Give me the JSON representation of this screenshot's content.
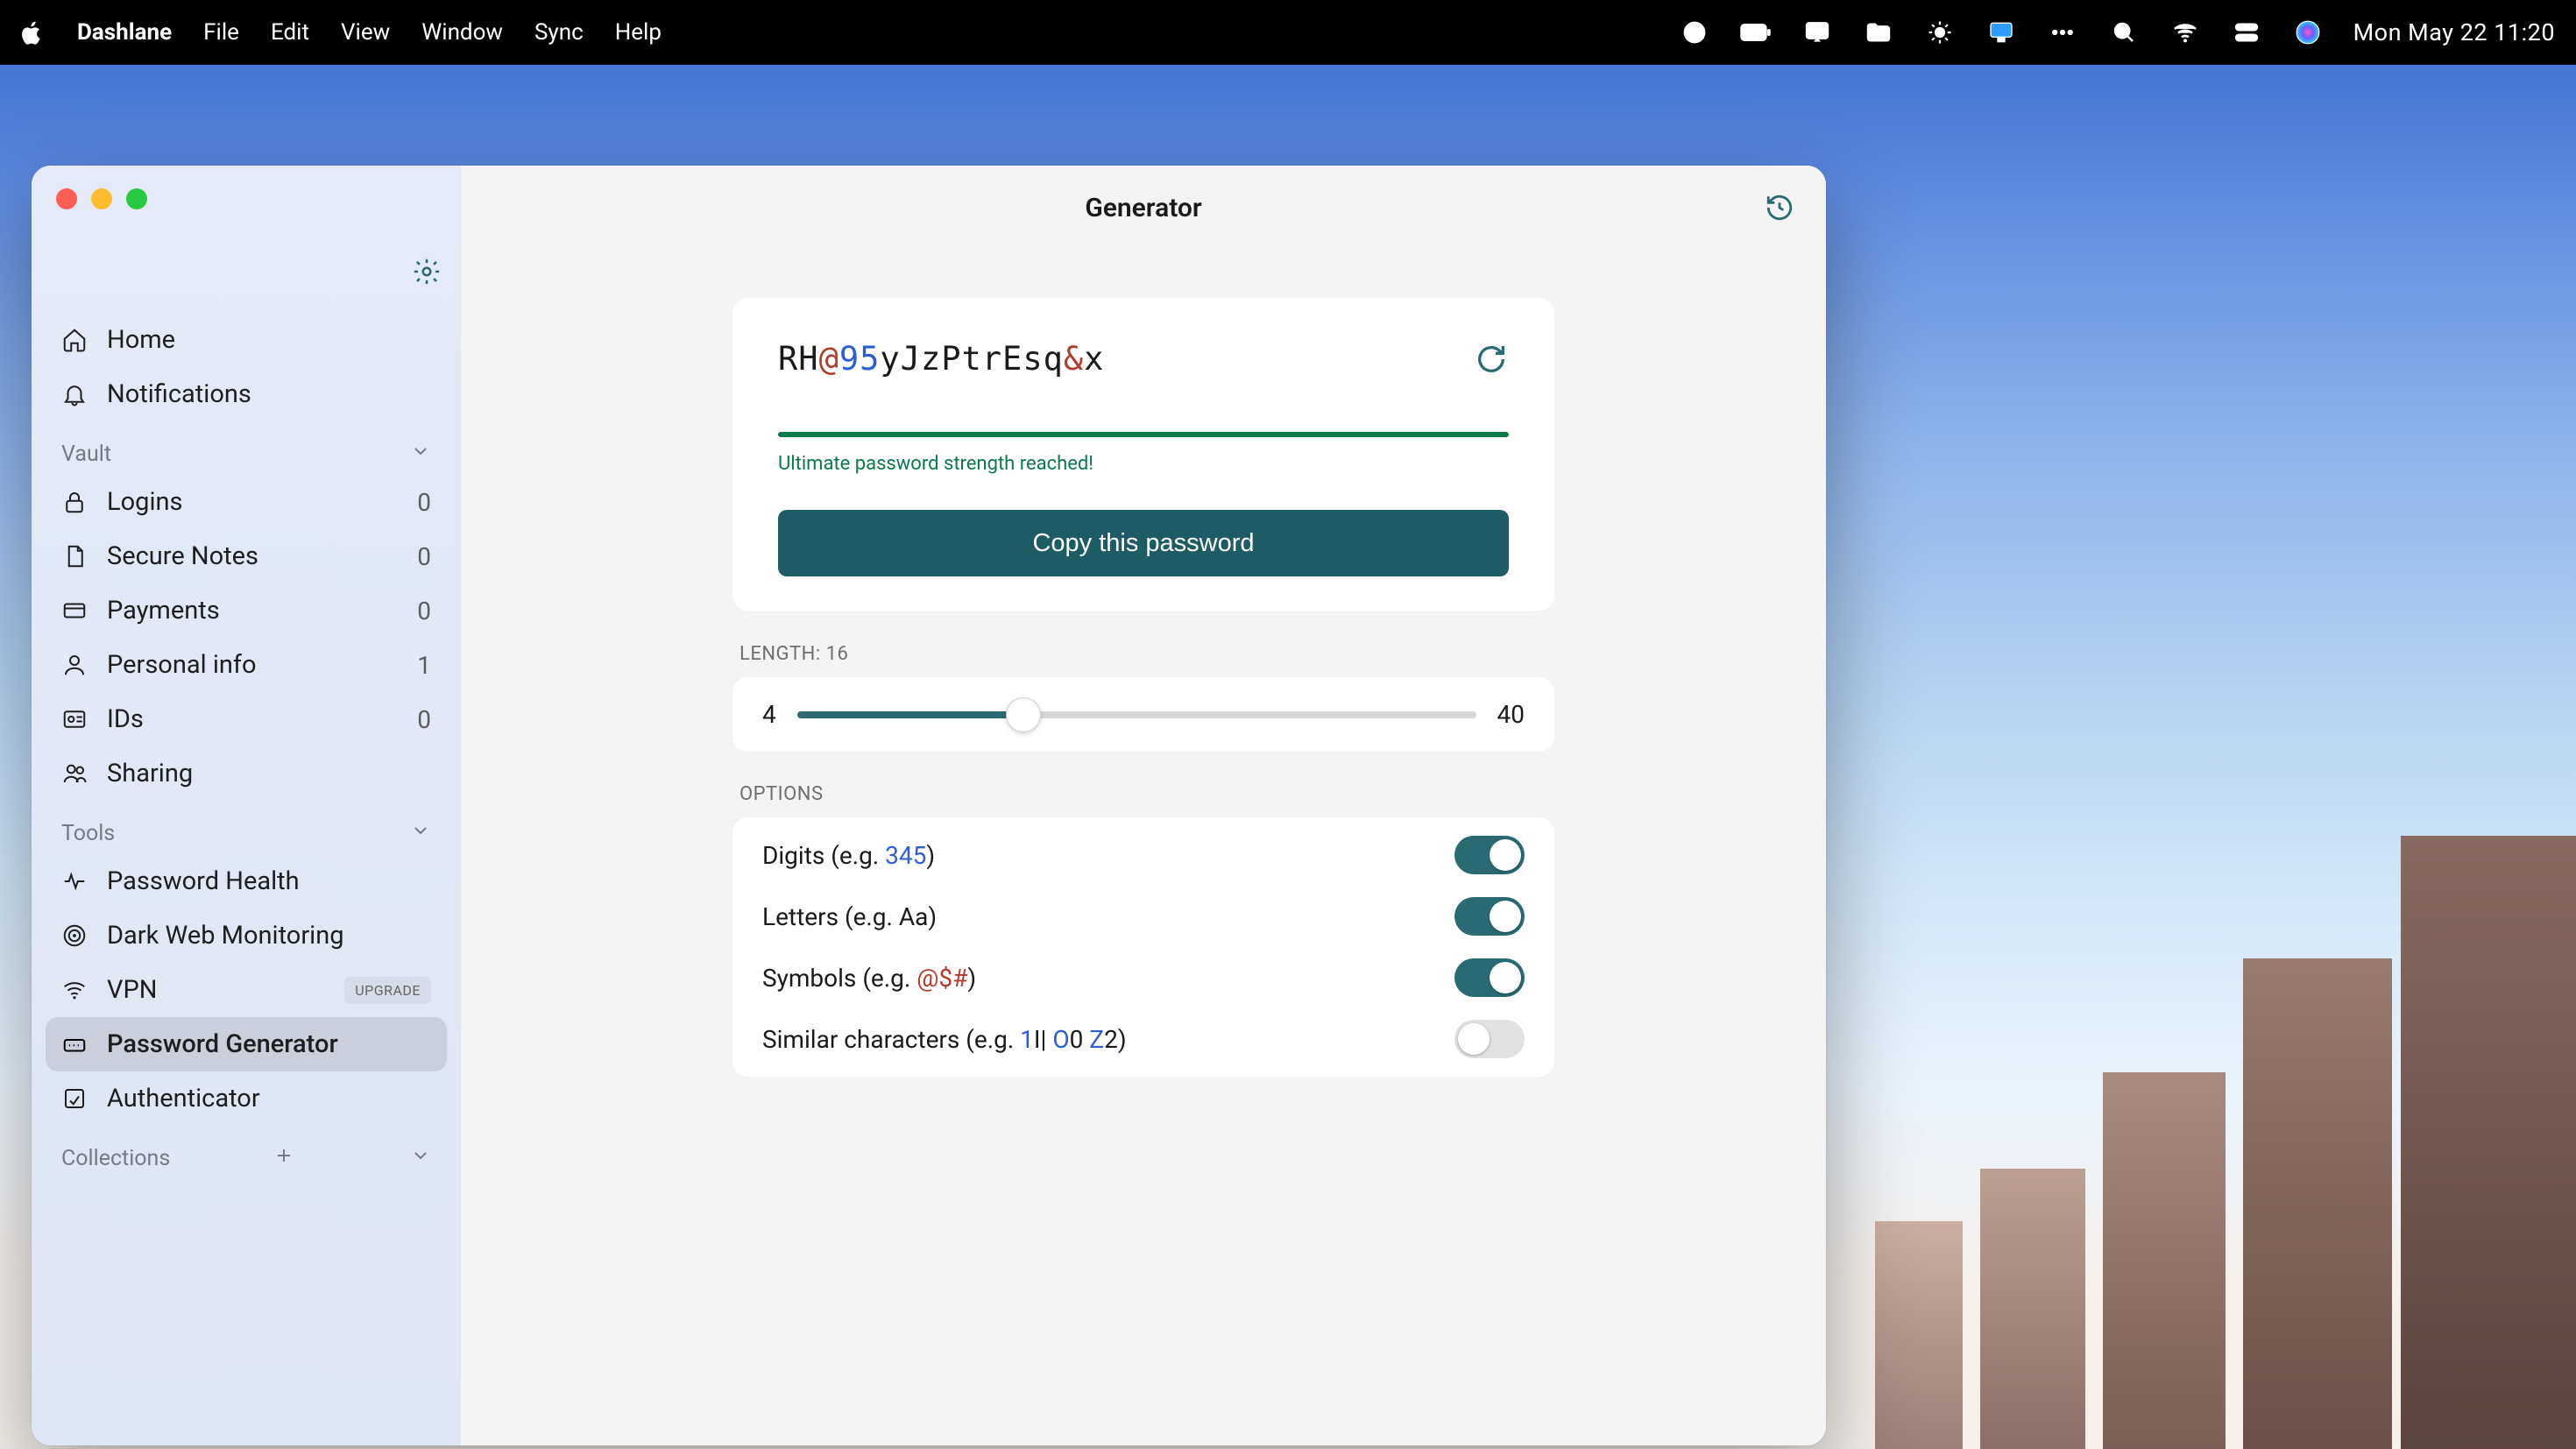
{
  "menubar": {
    "app": "Dashlane",
    "items": [
      "File",
      "Edit",
      "View",
      "Window",
      "Sync",
      "Help"
    ],
    "datetime": "Mon May 22  11:20"
  },
  "window": {
    "title": "Generator"
  },
  "sidebar": {
    "top": [
      {
        "id": "home",
        "label": "Home"
      },
      {
        "id": "notifications",
        "label": "Notifications"
      }
    ],
    "vault_label": "Vault",
    "vault": [
      {
        "id": "logins",
        "label": "Logins",
        "count": "0"
      },
      {
        "id": "secure-notes",
        "label": "Secure Notes",
        "count": "0"
      },
      {
        "id": "payments",
        "label": "Payments",
        "count": "0"
      },
      {
        "id": "personal-info",
        "label": "Personal info",
        "count": "1"
      },
      {
        "id": "ids",
        "label": "IDs",
        "count": "0"
      },
      {
        "id": "sharing",
        "label": "Sharing"
      }
    ],
    "tools_label": "Tools",
    "tools": [
      {
        "id": "password-health",
        "label": "Password Health"
      },
      {
        "id": "dark-web",
        "label": "Dark Web Monitoring"
      },
      {
        "id": "vpn",
        "label": "VPN",
        "badge": "UPGRADE"
      },
      {
        "id": "password-generator",
        "label": "Password Generator",
        "active": true
      },
      {
        "id": "authenticator",
        "label": "Authenticator"
      }
    ],
    "collections_label": "Collections"
  },
  "generator": {
    "password_segments": [
      {
        "t": "RH",
        "c": "plain"
      },
      {
        "t": "@",
        "c": "sym"
      },
      {
        "t": "95",
        "c": "num"
      },
      {
        "t": "yJzPtrEsq",
        "c": "plain"
      },
      {
        "t": "&",
        "c": "sym"
      },
      {
        "t": "x",
        "c": "plain"
      }
    ],
    "strength_text": "Ultimate password strength reached!",
    "copy_label": "Copy this password",
    "length_label": "LENGTH: 16",
    "length_value": 16,
    "slider_min": "4",
    "slider_max": "40",
    "options_label": "OPTIONS",
    "options": {
      "digits": {
        "prefix": "Digits (e.g. ",
        "hint": "345",
        "suffix": ")",
        "hintClass": "hint-num",
        "on": true
      },
      "letters": {
        "prefix": "Letters (e.g. ",
        "hint": "Aa",
        "suffix": ")",
        "hintClass": "",
        "on": true
      },
      "symbols": {
        "prefix": "Symbols (e.g. ",
        "hint": "@$#",
        "suffix": ")",
        "hintClass": "hint-sym",
        "on": true
      },
      "similar": {
        "parts": [
          {
            "t": "Similar characters (e.g. ",
            "c": ""
          },
          {
            "t": "1",
            "c": "hint-num"
          },
          {
            "t": "I| ",
            "c": ""
          },
          {
            "t": "O",
            "c": "hint-num"
          },
          {
            "t": "0 ",
            "c": ""
          },
          {
            "t": "Z",
            "c": "hint-num"
          },
          {
            "t": "2",
            "c": ""
          },
          {
            "t": ")",
            "c": ""
          }
        ],
        "on": false
      }
    }
  },
  "colors": {
    "accent": "#2a6b73",
    "success": "#0b7a4b",
    "symbol": "#b43c2e",
    "number": "#2d5fd1"
  }
}
